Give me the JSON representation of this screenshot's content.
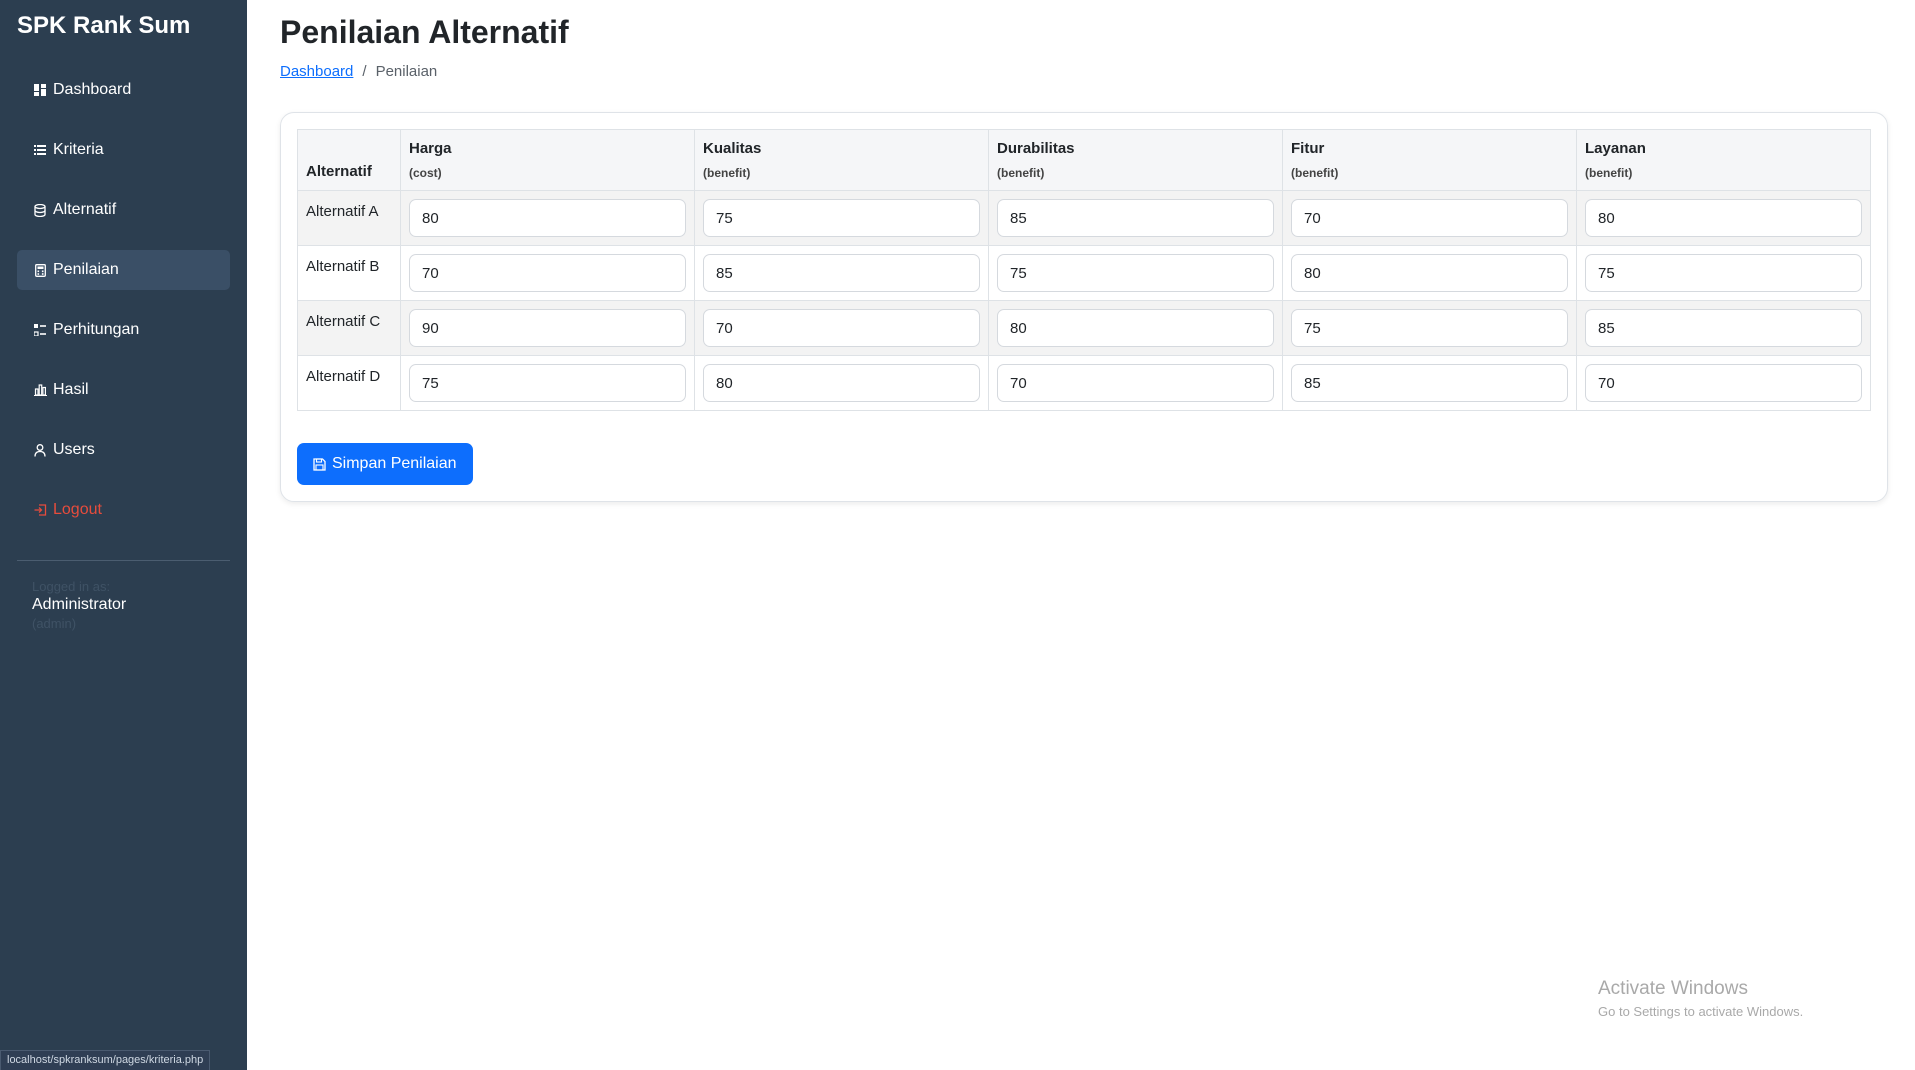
{
  "app": {
    "title": "SPK Rank Sum"
  },
  "sidebar": {
    "items": [
      {
        "label": "Dashboard",
        "icon": "grid-icon"
      },
      {
        "label": "Kriteria",
        "icon": "list-icon"
      },
      {
        "label": "Alternatif",
        "icon": "database-icon"
      },
      {
        "label": "Penilaian",
        "icon": "calculator-icon",
        "active": true
      },
      {
        "label": "Perhitungan",
        "icon": "calculation-icon"
      },
      {
        "label": "Hasil",
        "icon": "bar-chart-icon"
      },
      {
        "label": "Users",
        "icon": "person-icon"
      },
      {
        "label": "Logout",
        "icon": "logout-icon"
      }
    ],
    "user": {
      "caption": "Logged in as:",
      "name": "Administrator",
      "role": "(admin)"
    }
  },
  "page": {
    "title": "Penilaian Alternatif",
    "breadcrumb": {
      "home": "Dashboard",
      "current": "Penilaian",
      "separator": "/"
    }
  },
  "table": {
    "first_header": "Alternatif",
    "criteria": [
      {
        "name": "Harga",
        "type": "(cost)"
      },
      {
        "name": "Kualitas",
        "type": "(benefit)"
      },
      {
        "name": "Durabilitas",
        "type": "(benefit)"
      },
      {
        "name": "Fitur",
        "type": "(benefit)"
      },
      {
        "name": "Layanan",
        "type": "(benefit)"
      }
    ],
    "rows": [
      {
        "name": "Alternatif A",
        "values": [
          "80",
          "75",
          "85",
          "70",
          "80"
        ]
      },
      {
        "name": "Alternatif B",
        "values": [
          "70",
          "85",
          "75",
          "80",
          "75"
        ]
      },
      {
        "name": "Alternatif C",
        "values": [
          "90",
          "70",
          "80",
          "75",
          "85"
        ]
      },
      {
        "name": "Alternatif D",
        "values": [
          "75",
          "80",
          "70",
          "85",
          "70"
        ]
      }
    ]
  },
  "actions": {
    "save_label": "Simpan Penilaian",
    "save_icon": "floppy-disk-icon"
  },
  "watermark": {
    "title": "Activate Windows",
    "subtitle": "Go to Settings to activate Windows."
  },
  "status_bar": {
    "url": "localhost/spkranksum/pages/kriteria.php"
  },
  "colors": {
    "sidebar": "#2c3e50",
    "primary": "#0d6efd",
    "logout": "#e74c3c"
  }
}
